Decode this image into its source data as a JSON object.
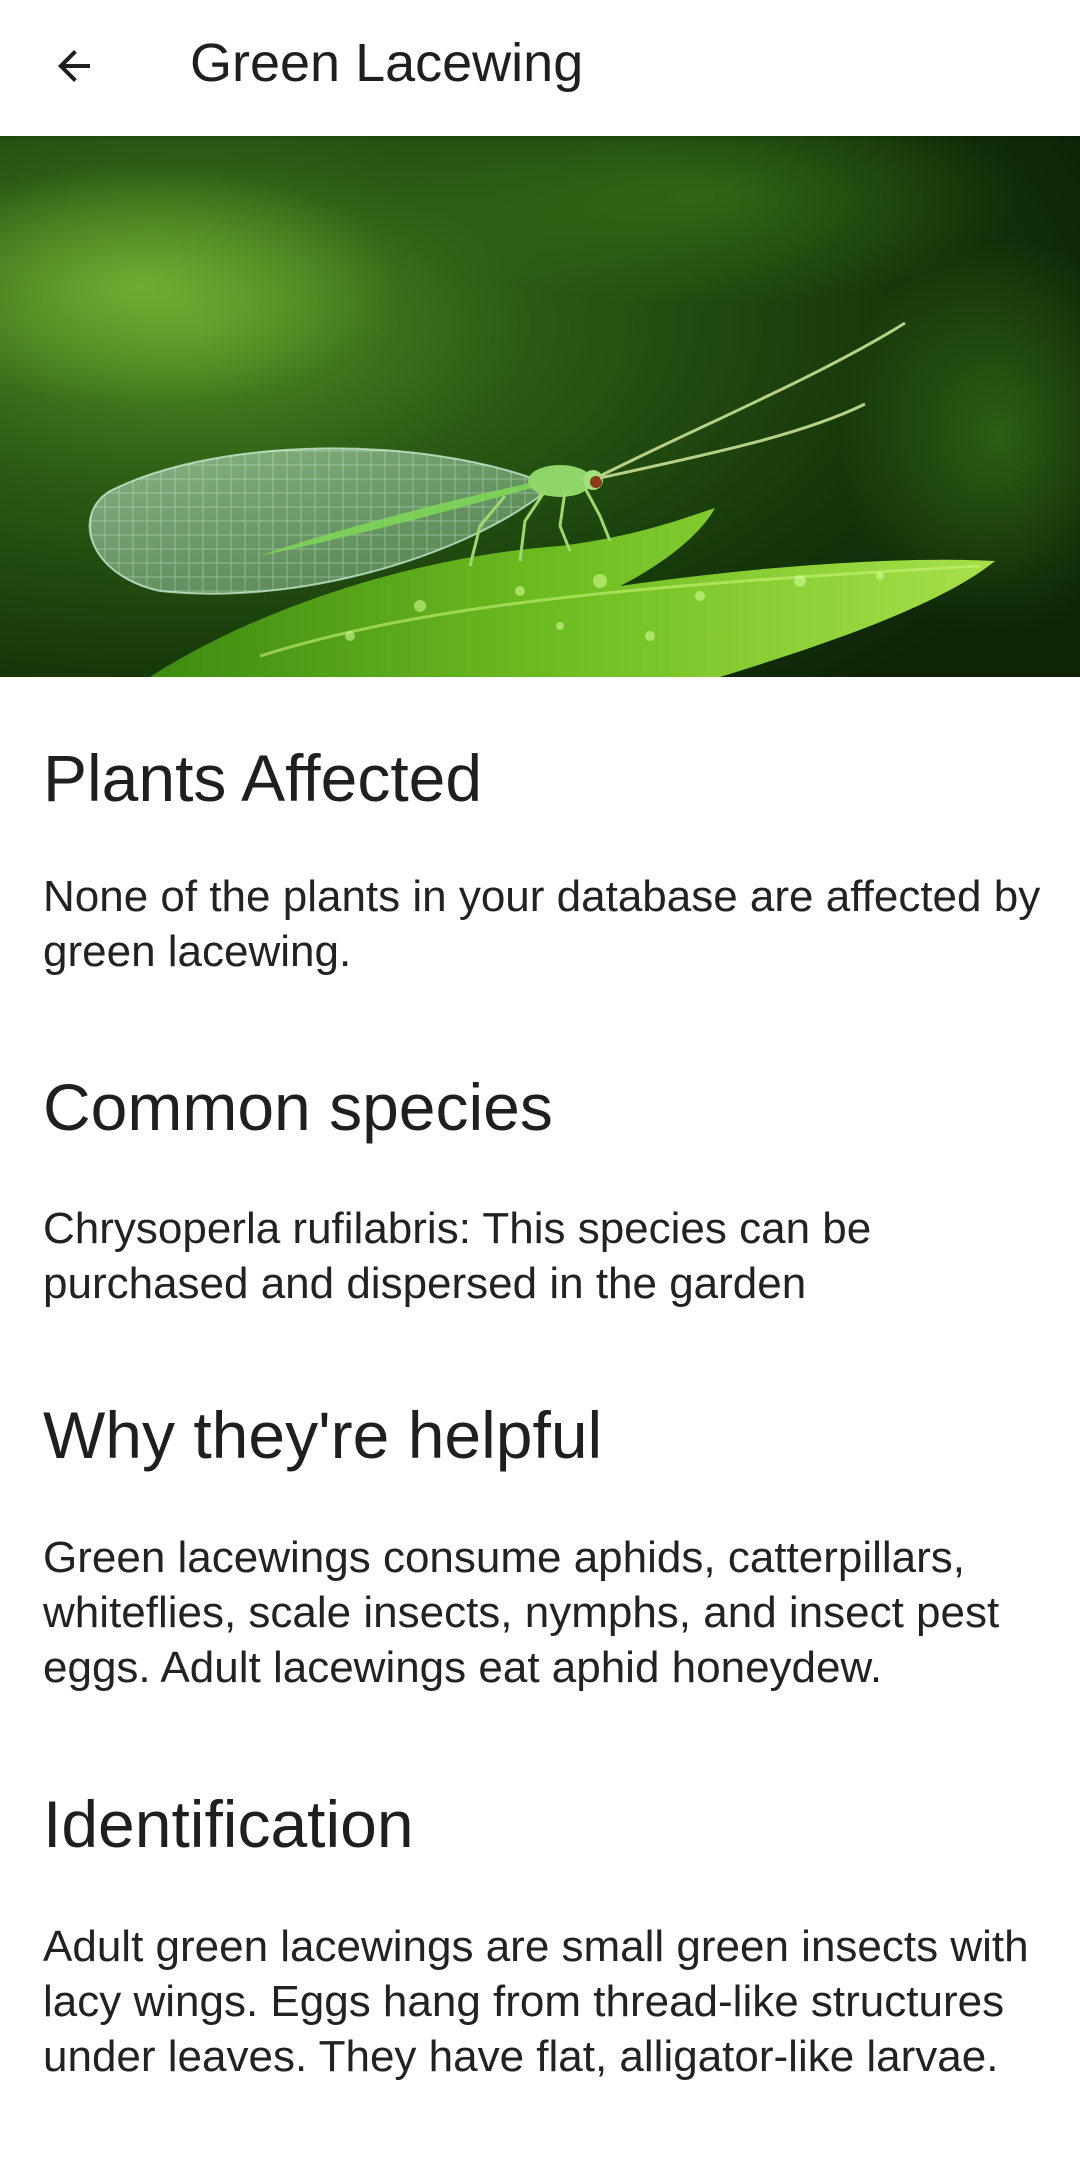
{
  "appbar": {
    "title": "Green Lacewing",
    "back_icon": "arrow-back-icon"
  },
  "hero": {
    "image_subject": "green lacewing insect on a leaf"
  },
  "sections": [
    {
      "heading": "Plants Affected",
      "body": "None of the plants in your database are affected by green lacewing."
    },
    {
      "heading": "Common species",
      "body": "Chrysoperla rufilabris: This species can be purchased and dispersed in the garden"
    },
    {
      "heading": "Why they're helpful",
      "body": "Green lacewings consume aphids, catterpillars, whiteflies, scale insects, nymphs, and insect pest eggs. Adult lacewings eat aphid honeydew."
    },
    {
      "heading": "Identification",
      "body": "Adult green lacewings are small green insects with lacy wings. Eggs hang from thread-like structures under leaves. They have flat, alligator-like larvae."
    }
  ],
  "colors": {
    "background": "#ffffff",
    "text": "#1f1f1f",
    "hero_dark": "#0f2a0a",
    "leaf": "#5da81c"
  }
}
